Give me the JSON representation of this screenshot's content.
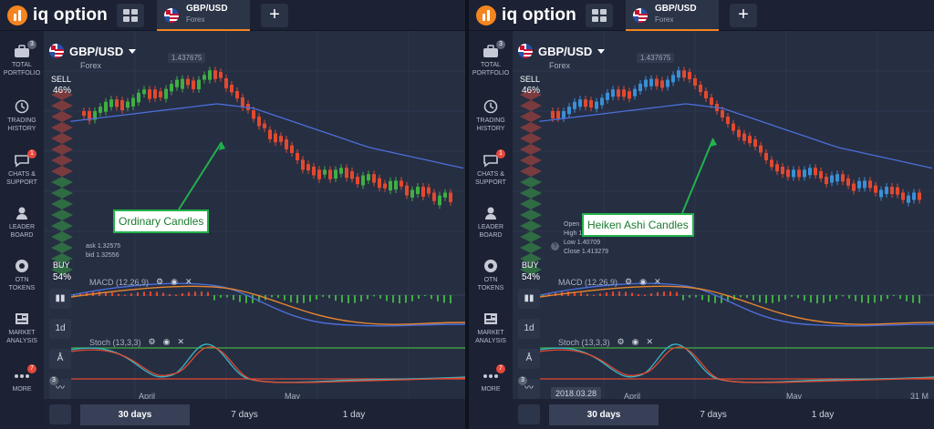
{
  "app": {
    "logo_text": "iq option"
  },
  "tab": {
    "name": "GBP/USD",
    "sub": "Forex"
  },
  "sidebar": [
    {
      "label_1": "TOTAL",
      "label_2": "PORTFOLIO",
      "icon": "briefcase-icon",
      "badge": "3"
    },
    {
      "label_1": "TRADING",
      "label_2": "HISTORY",
      "icon": "history-icon",
      "badge": ""
    },
    {
      "label_1": "CHATS &",
      "label_2": "SUPPORT",
      "icon": "chat-icon",
      "badge": "1"
    },
    {
      "label_1": "LEADER",
      "label_2": "BOARD",
      "icon": "leaderboard-icon",
      "badge": ""
    },
    {
      "label_1": "OTN",
      "label_2": "TOKENS",
      "icon": "token-icon",
      "badge": ""
    },
    {
      "label_1": "MARKET",
      "label_2": "ANALYSIS",
      "icon": "news-icon",
      "badge": ""
    },
    {
      "label_1": "MORE",
      "label_2": "",
      "icon": "more-icon",
      "badge": "7"
    }
  ],
  "chart": {
    "pair": "GBP/USD",
    "pair_sub": "Forex",
    "price_tag": "1.437675",
    "sell_label": "SELL",
    "sell_pct": "46%",
    "buy_label": "BUY",
    "buy_pct": "54%",
    "ask": "ask 1.32575",
    "bid": "bid 1.32556",
    "macd_label": "MACD (12,26,9)",
    "stoch_label": "Stoch (13,3,3)",
    "month_april": "April",
    "month_may": "May",
    "month_may_right": "May",
    "right_edge_label": "31 M",
    "date_badge": "2018.03.28",
    "tool_1d": "1d",
    "tool_badge": "3",
    "ohlc": {
      "open": "Open  1.41701",
      "high": "High   1.42005",
      "low": "Low    1.40709",
      "close": "Close  1.413279"
    }
  },
  "callouts": {
    "left": "Ordinary Candles",
    "right": "Heiken Ashi Candles"
  },
  "ranges": [
    "30 days",
    "7 days",
    "1 day"
  ],
  "colors": {
    "accent": "#f5851f",
    "up_candle_left": "#3fae43",
    "up_candle_right": "#3a8fd6",
    "down_candle": "#e2492f",
    "callout_border": "#22b24c"
  }
}
